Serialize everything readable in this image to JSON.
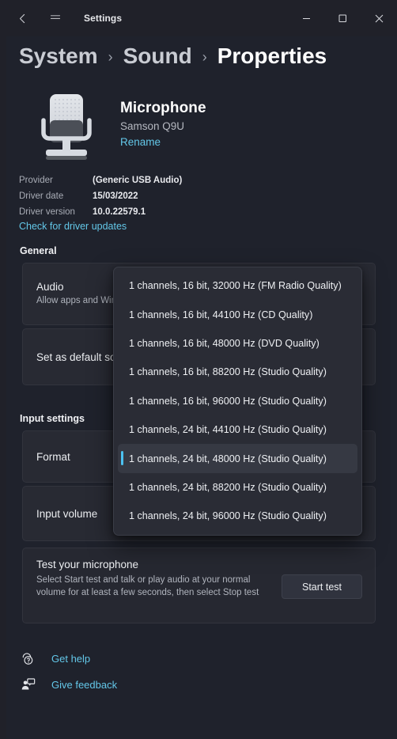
{
  "window": {
    "title": "Settings",
    "back_icon": "back-arrow-icon",
    "menu_icon": "hamburger-menu-icon",
    "minimize_label": "–",
    "maximize_label": "☐",
    "close_label": "✕"
  },
  "breadcrumb": {
    "items": [
      "System",
      "Sound",
      "Properties"
    ],
    "separator": "›"
  },
  "device": {
    "icon": "microphone-icon",
    "name": "Microphone",
    "model": "Samson Q9U",
    "rename_label": "Rename",
    "info": [
      {
        "label": "Provider",
        "value": "(Generic USB Audio)"
      },
      {
        "label": "Driver date",
        "value": "15/03/2022"
      },
      {
        "label": "Driver version",
        "value": "10.0.22579.1"
      }
    ],
    "driver_update_link": "Check for driver updates"
  },
  "sections": {
    "general_heading": "General",
    "input_heading": "Input settings"
  },
  "cards": {
    "audio": {
      "title": "Audio",
      "subtitle": "Allow apps and Windows to use this device for audio"
    },
    "default": {
      "title": "Set as default sound device"
    },
    "format": {
      "title": "Format"
    },
    "volume": {
      "title": "Input volume"
    },
    "test": {
      "title": "Test your microphone",
      "subtitle": "Select Start test and talk or play audio at your normal volume for at least a few seconds, then select Stop test",
      "button_label": "Start test"
    }
  },
  "footer": {
    "help": {
      "icon": "help-question-icon",
      "label": "Get help"
    },
    "feedback": {
      "icon": "feedback-person-icon",
      "label": "Give feedback"
    }
  },
  "format_dropdown": {
    "open": true,
    "selected_index": 6,
    "options": [
      "1 channels, 16 bit, 32000 Hz (FM Radio Quality)",
      "1 channels, 16 bit, 44100 Hz (CD Quality)",
      "1 channels, 16 bit, 48000 Hz (DVD Quality)",
      "1 channels, 16 bit, 88200 Hz (Studio Quality)",
      "1 channels, 16 bit, 96000 Hz (Studio Quality)",
      "1 channels, 24 bit, 44100 Hz (Studio Quality)",
      "1 channels, 24 bit, 48000 Hz (Studio Quality)",
      "1 channels, 24 bit, 88200 Hz (Studio Quality)",
      "1 channels, 24 bit, 96000 Hz (Studio Quality)"
    ]
  },
  "colors": {
    "accent": "#4cc2f1",
    "link": "#63c7e8",
    "page_bg": "#1f222c",
    "card_bg": "#282a33",
    "flyout_bg": "#2a2c35"
  }
}
